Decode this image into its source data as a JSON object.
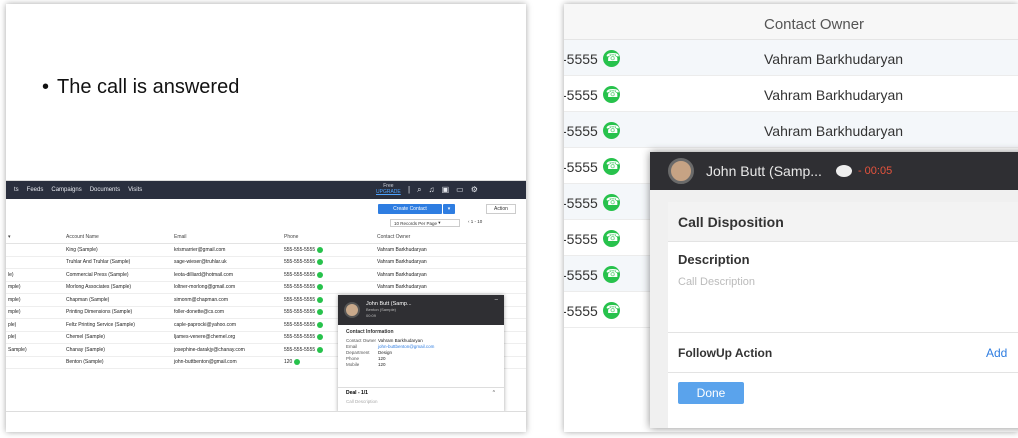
{
  "slide1": {
    "bullet": "The call is answered",
    "nav": {
      "items": [
        "ts",
        "Feeds",
        "Campaigns",
        "Documents",
        "Visits"
      ],
      "free_label": "Free",
      "upgrade_label": "UPGRADE"
    },
    "toolbar": {
      "create_label": "Create Contact",
      "actions_label": "Action",
      "per_page": "10 Records Per Page",
      "pager": "1 - 10"
    },
    "table": {
      "headers": [
        "",
        "Account Name",
        "Email",
        "Phone",
        "Contact Owner"
      ],
      "rows": [
        {
          "c0": "",
          "account": "King (Sample)",
          "email": "krismarrier@gmail.com",
          "phone": "555-555-5555",
          "owner": "Vahram Barkhudaryan"
        },
        {
          "c0": "",
          "account": "Truhlar And Truhlar (Sample)",
          "email": "sage-wieser@truhlar.uk",
          "phone": "555-555-5555",
          "owner": "Vahram Barkhudaryan"
        },
        {
          "c0": "le)",
          "account": "Commercial Press (Sample)",
          "email": "leota-dilliard@hotmail.com",
          "phone": "555-555-5555",
          "owner": "Vahram Barkhudaryan"
        },
        {
          "c0": "mple)",
          "account": "Morlong Associates (Sample)",
          "email": "loltner-morlong@gmail.com",
          "phone": "555-555-5555",
          "owner": "Vahram Barkhudaryan"
        },
        {
          "c0": "mple)",
          "account": "Chapman (Sample)",
          "email": "simonm@chapman.com",
          "phone": "555-555-5555",
          "owner": ""
        },
        {
          "c0": "mple)",
          "account": "Printing Dimensions (Sample)",
          "email": "foller-donette@cs.com",
          "phone": "555-555-5555",
          "owner": ""
        },
        {
          "c0": "ple)",
          "account": "Feltz Printing Service (Sample)",
          "email": "caple-paprocki@yahoo.com",
          "phone": "555-555-5555",
          "owner": ""
        },
        {
          "c0": "ple)",
          "account": "Chemel (Sample)",
          "email": "ljames-venere@chemel.org",
          "phone": "555-555-5555",
          "owner": ""
        },
        {
          "c0": "Sample)",
          "account": "Chanay (Sample)",
          "email": "josephine-darakjy@chanay.com",
          "phone": "555-555-5555",
          "owner": ""
        },
        {
          "c0": "",
          "account": "Benton (Sample)",
          "email": "john-buttbenton@gmail.com",
          "phone": "120",
          "owner": ""
        }
      ]
    },
    "popup": {
      "name": "John Butt (Samp...",
      "sub1": "Benton (Sample)",
      "sub2": "00:09",
      "section": "Contact Information",
      "fields": [
        {
          "k": "Contact Owner",
          "v": "Vahram Barkhudaryan"
        },
        {
          "k": "Email",
          "v": "john-buttbenton@gmail.com"
        },
        {
          "k": "Department",
          "v": "Design"
        },
        {
          "k": "Phone",
          "v": "120"
        },
        {
          "k": "Mobile",
          "v": "120"
        }
      ],
      "deal": "Deal - 1/1",
      "call_placeholder": "Call Description"
    }
  },
  "slide2": {
    "owner_header": "Contact Owner",
    "rows": [
      {
        "phone": "-5555",
        "owner": "Vahram Barkhudaryan"
      },
      {
        "phone": "-5555",
        "owner": "Vahram Barkhudaryan"
      },
      {
        "phone": "-5555",
        "owner": "Vahram Barkhudaryan"
      },
      {
        "phone": "-5555",
        "owner": ""
      },
      {
        "phone": "-5555",
        "owner": ""
      },
      {
        "phone": "-5555",
        "owner": ""
      },
      {
        "phone": "-5555",
        "owner": ""
      },
      {
        "phone": "-5555",
        "owner": ""
      }
    ],
    "popup": {
      "name": "John Butt (Samp...",
      "timer": "- 00:05",
      "disposition": "Call Disposition",
      "description_label": "Description",
      "description_placeholder": "Call Description",
      "followup_label": "FollowUp Action",
      "add_label": "Add",
      "done_label": "Done"
    }
  },
  "colors": {
    "nav_bg": "#2a2f3e",
    "accent_blue": "#2e7de1",
    "call_green": "#27c24c",
    "popup_header": "#2f2f33",
    "timer_red": "#e5533d"
  }
}
